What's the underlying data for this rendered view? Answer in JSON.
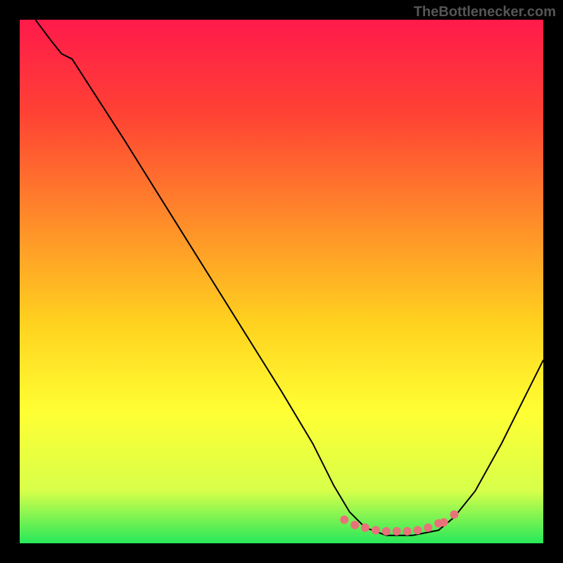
{
  "watermark": "TheBottlenecker.com",
  "chart_data": {
    "type": "line",
    "title": "",
    "xlabel": "",
    "ylabel": "",
    "x_range": [
      0,
      100
    ],
    "y_range": [
      0,
      100
    ],
    "gradient_stops": [
      {
        "offset": 0,
        "color": "#ff1a4b"
      },
      {
        "offset": 18,
        "color": "#ff4234"
      },
      {
        "offset": 38,
        "color": "#ff8a2a"
      },
      {
        "offset": 58,
        "color": "#ffd21f"
      },
      {
        "offset": 75,
        "color": "#ffff33"
      },
      {
        "offset": 90,
        "color": "#d7ff4a"
      },
      {
        "offset": 100,
        "color": "#27e85a"
      }
    ],
    "series": [
      {
        "name": "curve",
        "type": "line",
        "color": "#000000",
        "points": [
          {
            "x": 3,
            "y": 100
          },
          {
            "x": 6,
            "y": 96
          },
          {
            "x": 8,
            "y": 93.5
          },
          {
            "x": 10,
            "y": 92.5
          },
          {
            "x": 20,
            "y": 77
          },
          {
            "x": 30,
            "y": 61
          },
          {
            "x": 40,
            "y": 45
          },
          {
            "x": 50,
            "y": 29
          },
          {
            "x": 56,
            "y": 19
          },
          {
            "x": 60,
            "y": 11
          },
          {
            "x": 63,
            "y": 6
          },
          {
            "x": 66,
            "y": 3
          },
          {
            "x": 70,
            "y": 1.5
          },
          {
            "x": 75,
            "y": 1.5
          },
          {
            "x": 80,
            "y": 2.5
          },
          {
            "x": 83,
            "y": 5
          },
          {
            "x": 87,
            "y": 10
          },
          {
            "x": 92,
            "y": 19
          },
          {
            "x": 96,
            "y": 27
          },
          {
            "x": 100,
            "y": 35
          }
        ]
      },
      {
        "name": "marker-band",
        "type": "scatter",
        "color": "#e9727a",
        "points": [
          {
            "x": 62,
            "y": 4.5
          },
          {
            "x": 64,
            "y": 3.5
          },
          {
            "x": 66,
            "y": 3
          },
          {
            "x": 68,
            "y": 2.5
          },
          {
            "x": 70,
            "y": 2.3
          },
          {
            "x": 72,
            "y": 2.3
          },
          {
            "x": 74,
            "y": 2.3
          },
          {
            "x": 76,
            "y": 2.5
          },
          {
            "x": 78,
            "y": 3
          },
          {
            "x": 80,
            "y": 3.8
          },
          {
            "x": 81,
            "y": 4
          },
          {
            "x": 83,
            "y": 5.5
          }
        ]
      }
    ]
  }
}
